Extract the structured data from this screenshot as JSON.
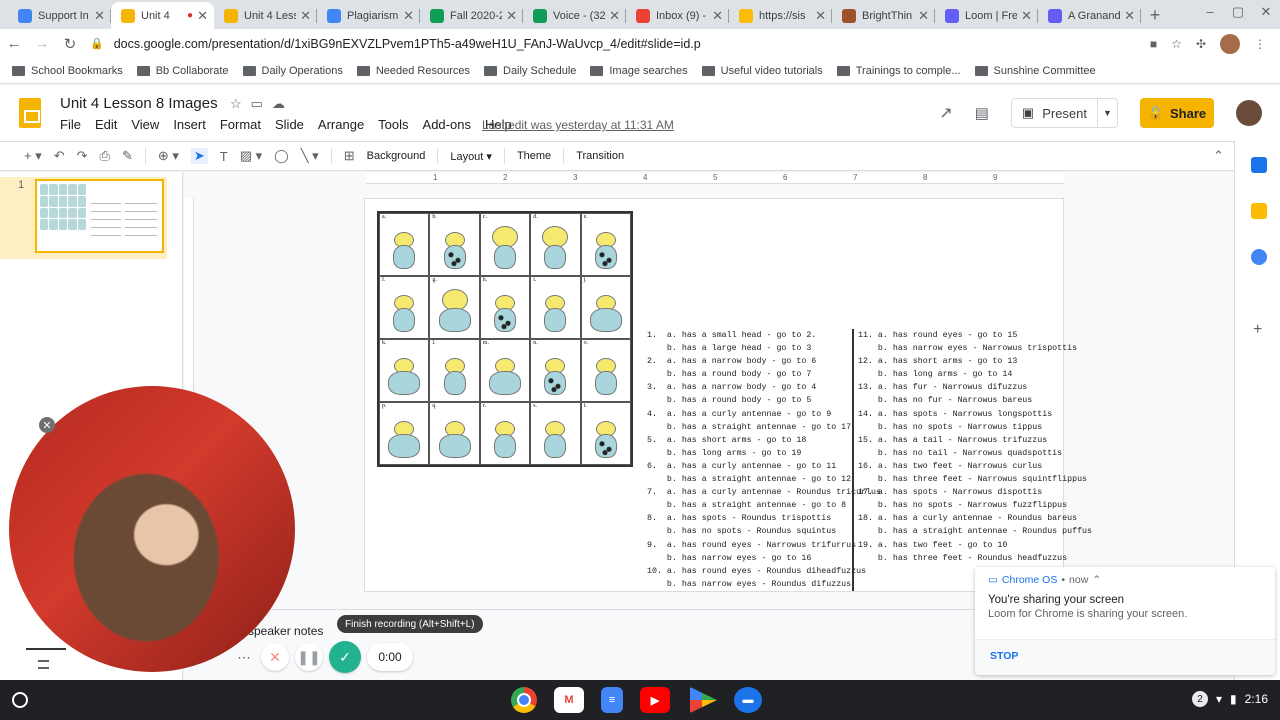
{
  "browser": {
    "tabs": [
      {
        "label": "Support In",
        "color": "#4285f4",
        "active": false
      },
      {
        "label": "Unit 4",
        "color": "#f4b400",
        "active": true,
        "recording": true
      },
      {
        "label": "Unit 4 Less",
        "color": "#f4b400",
        "active": false
      },
      {
        "label": "Plagiarism",
        "color": "#4285f4",
        "active": false
      },
      {
        "label": "Fall 2020-2",
        "color": "#0f9d58",
        "active": false
      },
      {
        "label": "Voice - (32",
        "color": "#0f9d58",
        "active": false
      },
      {
        "label": "Inbox (9) -",
        "color": "#ea4335",
        "active": false
      },
      {
        "label": "https://sis",
        "color": "#fbbc04",
        "active": false
      },
      {
        "label": "BrightThin",
        "color": "#a0522d",
        "active": false
      },
      {
        "label": "Loom | Fre",
        "color": "#625df5",
        "active": false
      },
      {
        "label": "A Granand",
        "color": "#625df5",
        "active": false
      }
    ],
    "url": "docs.google.com/presentation/d/1xiBG9nEXVZLPvem1PTh5-a49weH1U_FAnJ-WaUvcp_4/edit#slide=id.p",
    "bookmarks": [
      "School Bookmarks",
      "Bb Collaborate",
      "Daily Operations",
      "Needed Resources",
      "Daily Schedule",
      "Image searches",
      "Useful video tutorials",
      "Trainings to comple...",
      "Sunshine Committee"
    ]
  },
  "slides_app": {
    "title": "Unit 4 Lesson 8 Images",
    "menu": [
      "File",
      "Edit",
      "View",
      "Insert",
      "Format",
      "Slide",
      "Arrange",
      "Tools",
      "Add-ons",
      "Help"
    ],
    "last_edit": "Last edit was yesterday at 11:31 AM",
    "present_label": "Present",
    "share_label": "Share",
    "toolbar_buttons": [
      "Background",
      "Layout",
      "Theme",
      "Transition"
    ],
    "slide_number": "1",
    "ruler_marks": [
      "1",
      "1",
      "2",
      "3",
      "4",
      "5",
      "6",
      "7",
      "8",
      "9"
    ],
    "speaker_notes": "d speaker notes"
  },
  "slide": {
    "grid_letters": [
      "a.",
      "b.",
      "c.",
      "d.",
      "e.",
      "f.",
      "g.",
      "h.",
      "i.",
      "j.",
      "k.",
      "l.",
      "m.",
      "n.",
      "o.",
      "p.",
      "q.",
      "r.",
      "s.",
      "t."
    ],
    "key_left": [
      "1.  a. has a small head - go to 2.",
      "    b. has a large head - go to 3",
      "2.  a. has a narrow body - go to 6",
      "    b. has a round body - go to 7",
      "3.  a. has a narrow body - go to 4",
      "    b. has a round body - go to 5",
      "4.  a. has a curly antennae - go to 9",
      "    b. has a straight antennae - go to 17",
      "5.  a. has short arms - go to 18",
      "    b. has long arms - go to 19",
      "6.  a. has a curly antennae - go to 11",
      "    b. has a straight antennae - go to 12",
      "7.  a. has a curly antennae - Roundus tricurlus",
      "    b. has a straight antennae - go to 8",
      "8.  a. has spots - Roundus trispottis",
      "    b. has no spots - Roundus squintus",
      "9.  a. has round eyes - Narrowus trifurrus",
      "    b. has narrow eyes - go to 16",
      "10. a. has round eyes - Roundus diheadfuzzus",
      "    b. has narrow eyes - Roundus difuzzus"
    ],
    "key_right": [
      "11. a. has round eyes - go to 15",
      "    b. has narrow eyes - Narrowus trispottis",
      "12. a. has short arms - go to 13",
      "    b. has long arms - go to 14",
      "13. a. has fur - Narrowus difuzzus",
      "    b. has no fur - Narrowus bareus",
      "14. a. has spots - Narrowus longspottis",
      "    b. has no spots - Narrowus tippus",
      "15. a. has a tail - Narrowus trifuzzus",
      "    b. has no tail - Narrowus quadspottis",
      "16. a. has two feet - Narrowus curlus",
      "    b. has three feet - Narrowus squintflippus",
      "17. a. has spots - Narrowus dispottis",
      "    b. has no spots - Narrowus fuzzflippus",
      "18. a. has a curly antennae - Roundus bareus",
      "    b. has a straight antennae - Roundus puffus",
      "19. a. has two feet - go to 10",
      "    b. has three feet - Roundus headfuzzus"
    ]
  },
  "loom": {
    "tooltip": "Finish recording (Alt+Shift+L)",
    "timer": "0:00",
    "accent": "#22b290"
  },
  "notification": {
    "source": "Chrome OS",
    "time": "now",
    "title": "You're sharing your screen",
    "body": "Loom for Chrome is sharing your screen.",
    "action": "STOP"
  },
  "shelf": {
    "apps": [
      "chrome-icon",
      "gmail-icon",
      "docs-icon",
      "youtube-icon",
      "play-store-icon",
      "files-icon"
    ],
    "notification_count": "2",
    "time": "2:16"
  }
}
